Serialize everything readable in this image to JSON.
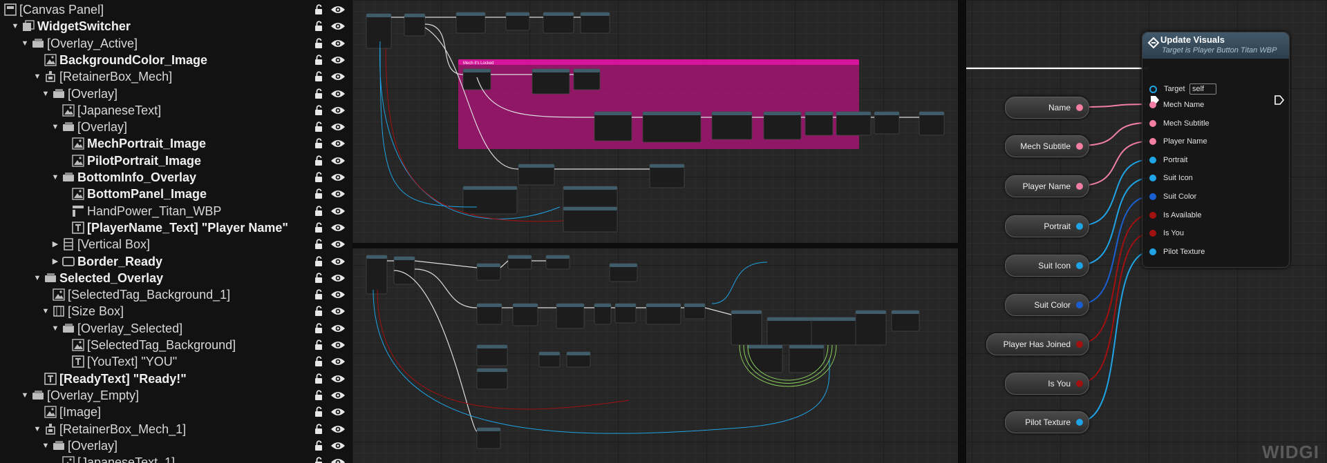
{
  "hierarchy": {
    "rows": [
      {
        "label": "[Canvas Panel]",
        "depth": 0,
        "arrow": "",
        "icon": "canvas-panel-icon",
        "bold": false
      },
      {
        "label": "WidgetSwitcher",
        "depth": 1,
        "arrow": "▼",
        "icon": "widget-switcher-icon",
        "bold": true
      },
      {
        "label": "[Overlay_Active]",
        "depth": 2,
        "arrow": "▼",
        "icon": "overlay-icon",
        "bold": false
      },
      {
        "label": "BackgroundColor_Image",
        "depth": 3,
        "arrow": "",
        "icon": "image-icon",
        "bold": true
      },
      {
        "label": "[RetainerBox_Mech]",
        "depth": 3,
        "arrow": "▼",
        "icon": "retainer-box-icon",
        "bold": false
      },
      {
        "label": "[Overlay]",
        "depth": 4,
        "arrow": "▼",
        "icon": "overlay-icon",
        "bold": false
      },
      {
        "label": "[JapaneseText]",
        "depth": 5,
        "arrow": "",
        "icon": "image-icon",
        "bold": false
      },
      {
        "label": "[Overlay]",
        "depth": 5,
        "arrow": "▼",
        "icon": "overlay-icon",
        "bold": false
      },
      {
        "label": "MechPortrait_Image",
        "depth": 6,
        "arrow": "",
        "icon": "image-icon",
        "bold": true
      },
      {
        "label": "PilotPortrait_Image",
        "depth": 6,
        "arrow": "",
        "icon": "image-icon",
        "bold": true
      },
      {
        "label": "BottomInfo_Overlay",
        "depth": 5,
        "arrow": "▼",
        "icon": "overlay-icon",
        "bold": true
      },
      {
        "label": "BottomPanel_Image",
        "depth": 6,
        "arrow": "",
        "icon": "image-icon",
        "bold": true
      },
      {
        "label": "HandPower_Titan_WBP",
        "depth": 6,
        "arrow": "",
        "icon": "user-widget-icon",
        "bold": false
      },
      {
        "label": "[PlayerName_Text] \"Player Name\"",
        "depth": 6,
        "arrow": "",
        "icon": "text-icon",
        "bold": true
      },
      {
        "label": "[Vertical Box]",
        "depth": 5,
        "arrow": "▶",
        "icon": "vertical-box-icon",
        "bold": false
      },
      {
        "label": "Border_Ready",
        "depth": 5,
        "arrow": "▶",
        "icon": "border-icon",
        "bold": true
      },
      {
        "label": "Selected_Overlay",
        "depth": 3,
        "arrow": "▼",
        "icon": "overlay-icon",
        "bold": true
      },
      {
        "label": "[SelectedTag_Background_1]",
        "depth": 4,
        "arrow": "",
        "icon": "image-icon",
        "bold": false
      },
      {
        "label": "[Size Box]",
        "depth": 4,
        "arrow": "▼",
        "icon": "size-box-icon",
        "bold": false
      },
      {
        "label": "[Overlay_Selected]",
        "depth": 5,
        "arrow": "▼",
        "icon": "overlay-icon",
        "bold": false
      },
      {
        "label": "[SelectedTag_Background]",
        "depth": 6,
        "arrow": "",
        "icon": "image-icon",
        "bold": false
      },
      {
        "label": "[YouText] \"YOU\"",
        "depth": 6,
        "arrow": "",
        "icon": "text-icon",
        "bold": false
      },
      {
        "label": "[ReadyText] \"Ready!\"",
        "depth": 3,
        "arrow": "",
        "icon": "text-icon",
        "bold": true
      },
      {
        "label": "[Overlay_Empty]",
        "depth": 2,
        "arrow": "▼",
        "icon": "overlay-icon",
        "bold": false
      },
      {
        "label": "[Image]",
        "depth": 3,
        "arrow": "",
        "icon": "image-icon",
        "bold": false
      },
      {
        "label": "[RetainerBox_Mech_1]",
        "depth": 3,
        "arrow": "▼",
        "icon": "retainer-box-icon",
        "bold": false
      },
      {
        "label": "[Overlay]",
        "depth": 4,
        "arrow": "▼",
        "icon": "overlay-icon",
        "bold": false
      },
      {
        "label": "[JapaneseText_1]",
        "depth": 5,
        "arrow": "",
        "icon": "image-icon",
        "bold": false
      }
    ]
  },
  "graph": {
    "comment_label": "Mech it's Locked",
    "watermark": "WIDGI"
  },
  "function_node": {
    "title": "Update Visuals",
    "subtitle": "Target is Player Button Titan WBP",
    "target_label": "Target",
    "target_value": "self",
    "pins": [
      {
        "label": "Mech Name",
        "color": "#f27fa3"
      },
      {
        "label": "Mech Subtitle",
        "color": "#f27fa3"
      },
      {
        "label": "Player Name",
        "color": "#f27fa3"
      },
      {
        "label": "Portrait",
        "color": "#1fa4e6"
      },
      {
        "label": "Suit Icon",
        "color": "#1fa4e6"
      },
      {
        "label": "Suit Color",
        "color": "#1a5fd1"
      },
      {
        "label": "Is Available",
        "color": "#a21010"
      },
      {
        "label": "Is You",
        "color": "#a21010"
      },
      {
        "label": "Pilot Texture",
        "color": "#1fa4e6"
      }
    ]
  },
  "getters": [
    {
      "label": "Name",
      "color": "#f27fa3"
    },
    {
      "label": "Mech Subtitle",
      "color": "#f27fa3"
    },
    {
      "label": "Player Name",
      "color": "#f27fa3"
    },
    {
      "label": "Portrait",
      "color": "#1fa4e6"
    },
    {
      "label": "Suit Icon",
      "color": "#1fa4e6"
    },
    {
      "label": "Suit Color",
      "color": "#1a5fd1"
    },
    {
      "label": "Player Has Joined",
      "color": "#a21010"
    },
    {
      "label": "Is You",
      "color": "#a21010"
    },
    {
      "label": "Pilot Texture",
      "color": "#1fa4e6"
    }
  ],
  "colors": {
    "string_pin": "#f27fa3",
    "object_pin": "#1fa4e6",
    "struct_pin": "#1a5fd1",
    "bool_pin": "#a21010",
    "comment_box": "#b8127f",
    "comment_header": "#d4159a"
  }
}
